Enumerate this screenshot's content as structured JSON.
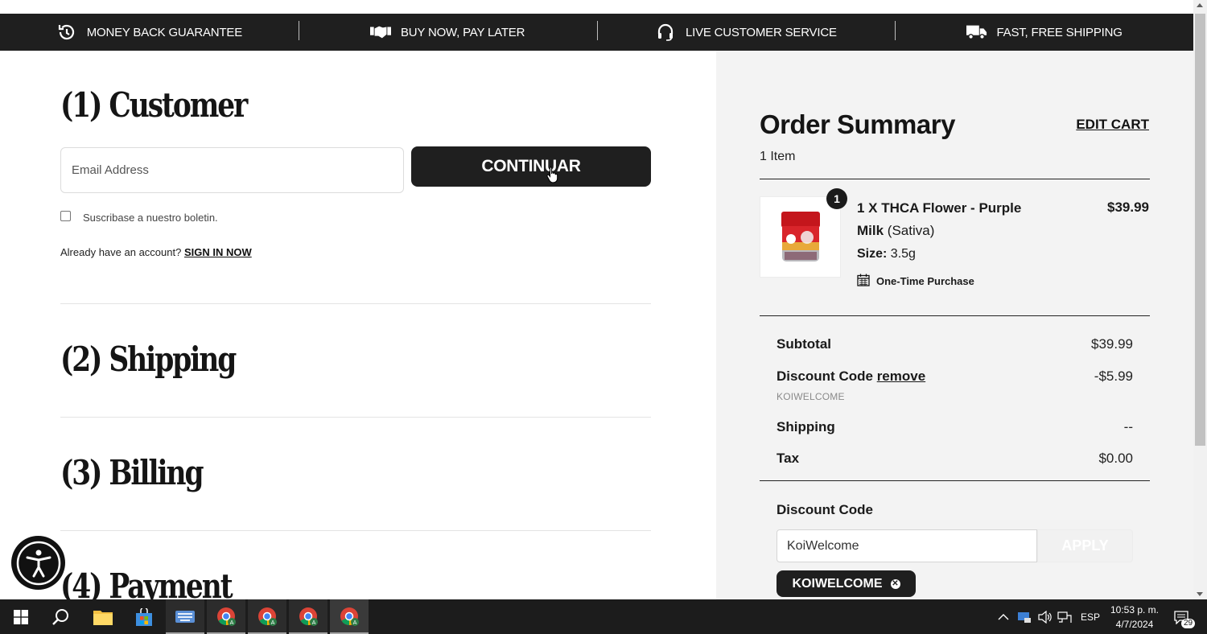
{
  "promo_bar": {
    "items": [
      {
        "label": "MONEY BACK GUARANTEE",
        "icon": "history-icon"
      },
      {
        "label": "BUY NOW, PAY LATER",
        "icon": "handshake-icon"
      },
      {
        "label": "LIVE CUSTOMER SERVICE",
        "icon": "headset-icon"
      },
      {
        "label": "FAST, FREE SHIPPING",
        "icon": "truck-icon"
      }
    ]
  },
  "checkout": {
    "customer_title": "(1) Customer",
    "email_placeholder": "Email Address",
    "continue_label": "CONTINUAR",
    "newsletter_label": "Suscribase a nuestro boletin.",
    "account_prompt": "Already have an account?",
    "sign_in_label": "SIGN IN NOW",
    "shipping_title": "(2) Shipping",
    "billing_title": "(3) Billing",
    "payment_title": "(4) Payment"
  },
  "summary": {
    "title": "Order Summary",
    "edit_cart_label": "EDIT CART",
    "item_count": "1 Item",
    "product": {
      "quantity_badge": "1",
      "name": "1 X THCA Flower - Purple Milk",
      "variant": "(Sativa)",
      "price": "$39.99",
      "size_label": "Size:",
      "size_value": "3.5g",
      "purchase_type": "One-Time Purchase"
    },
    "lines": {
      "subtotal_label": "Subtotal",
      "subtotal_value": "$39.99",
      "discount_label": "Discount Code",
      "discount_remove": "remove",
      "discount_value": "-$5.99",
      "discount_code": "KOIWELCOME",
      "shipping_label": "Shipping",
      "shipping_value": "--",
      "tax_label": "Tax",
      "tax_value": "$0.00"
    },
    "discount_form": {
      "label": "Discount Code",
      "input_value": "KoiWelcome",
      "apply_label": "APPLY",
      "applied_chip": "KOIWELCOME"
    }
  },
  "taskbar": {
    "language": "ESP",
    "time": "10:53 p. m.",
    "date": "4/7/2024",
    "notification_count": "29"
  }
}
